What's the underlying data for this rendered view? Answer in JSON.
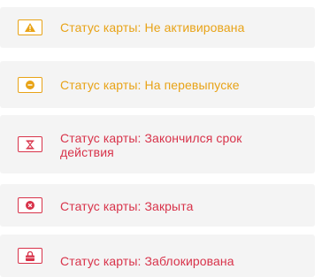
{
  "colors": {
    "warning": "#e8a317",
    "error": "#d8334a",
    "card_background": "#f4f4f4"
  },
  "statuses": [
    {
      "label": "Статус карты: Не активирована",
      "icon": "warning-triangle-icon",
      "severity": "warning"
    },
    {
      "label": "Статус карты: На перевыпуске",
      "icon": "reissue-circle-icon",
      "severity": "warning"
    },
    {
      "label": "Статус карты: Закончился срок действия",
      "icon": "hourglass-icon",
      "severity": "error"
    },
    {
      "label": "Статус карты: Закрыта",
      "icon": "close-circle-icon",
      "severity": "error"
    },
    {
      "label": "Статус карты: Заблокирована",
      "icon": "lock-icon",
      "severity": "error"
    }
  ]
}
